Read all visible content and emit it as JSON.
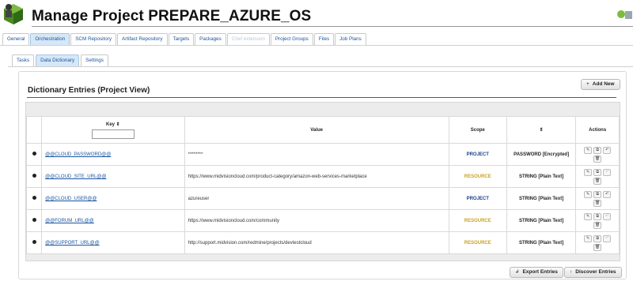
{
  "header": {
    "title": "Manage Project PREPARE_AZURE_OS",
    "logo_icon": "project-cube-icon",
    "corner_icon": "deploy-status-icon"
  },
  "tabs": [
    {
      "label": "General",
      "active": false,
      "disabled": false
    },
    {
      "label": "Orchestration",
      "active": true,
      "disabled": false
    },
    {
      "label": "SCM Repository",
      "active": false,
      "disabled": false
    },
    {
      "label": "Artifact Repository",
      "active": false,
      "disabled": false
    },
    {
      "label": "Targets",
      "active": false,
      "disabled": false
    },
    {
      "label": "Packages",
      "active": false,
      "disabled": false
    },
    {
      "label": "Chef extension",
      "active": false,
      "disabled": true
    },
    {
      "label": "Project Groups",
      "active": false,
      "disabled": false
    },
    {
      "label": "Files",
      "active": false,
      "disabled": false
    },
    {
      "label": "Job Plans",
      "active": false,
      "disabled": false
    }
  ],
  "subtabs": [
    {
      "label": "Tasks",
      "active": false
    },
    {
      "label": "Data Dictionary",
      "active": true
    },
    {
      "label": "Settings",
      "active": false
    }
  ],
  "panel": {
    "title": "Dictionary Entries (Project View)",
    "add_button": "Add New",
    "export_button": "Export Entries",
    "discover_button": "Discover Entries"
  },
  "table": {
    "columns": {
      "key": "Key ⇕",
      "value": "Value",
      "scope": "Scope",
      "type": "⇕",
      "actions": "Actions"
    },
    "rows": [
      {
        "key": "@@CLOUD_PASSWORD@@",
        "value": "********",
        "scope": "PROJECT",
        "type": "PASSWORD [Encrypted]"
      },
      {
        "key": "@@CLOUD_SITE_URL@@",
        "value": "https://www.midvisioncloud.com/product-category/amazon-web-services-marketplace",
        "scope": "RESOURCE",
        "type": "STRING [Plain Text]"
      },
      {
        "key": "@@CLOUD_USER@@",
        "value": "azureuser",
        "scope": "PROJECT",
        "type": "STRING [Plain Text]"
      },
      {
        "key": "@@FORUM_URL@@",
        "value": "https://www.midvisioncloud.com/community",
        "scope": "RESOURCE",
        "type": "STRING [Plain Text]"
      },
      {
        "key": "@@SUPPORT_URL@@",
        "value": "http://support.midvision.com/redmine/projects/devtestcloud",
        "scope": "RESOURCE",
        "type": "STRING [Plain Text]"
      }
    ]
  },
  "colors": {
    "link": "#1a55a0",
    "project_scope": "#1d3f8c",
    "resource_scope": "#c9a227",
    "active_tab": "#d6e7f7"
  }
}
